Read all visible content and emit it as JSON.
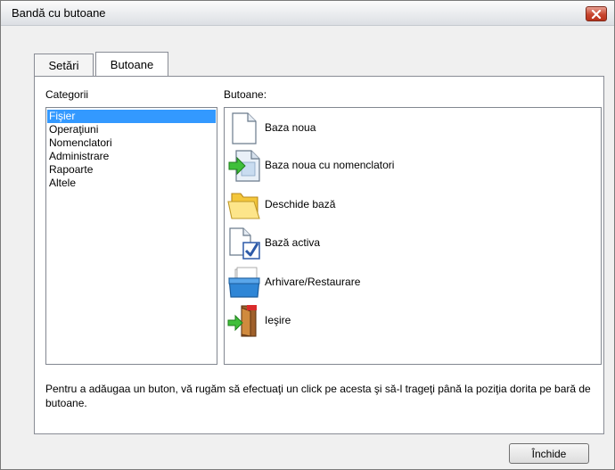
{
  "window": {
    "title": "Bandă cu butoane"
  },
  "tabs": [
    {
      "label": "Setări"
    },
    {
      "label": "Butoane"
    }
  ],
  "categories": {
    "label": "Categorii",
    "items": [
      "Fişier",
      "Operaţiuni",
      "Nomenclatori",
      "Administrare",
      "Rapoarte",
      "Altele"
    ],
    "selected": "Fişier"
  },
  "buttons": {
    "label": "Butoane:",
    "items": [
      {
        "label": "Baza noua",
        "icon": "new-document-icon"
      },
      {
        "label": "Baza noua cu nomenclatori",
        "icon": "new-document-arrow-icon"
      },
      {
        "label": "Deschide bază",
        "icon": "folder-open-icon"
      },
      {
        "label": "Bază activa",
        "icon": "document-check-icon"
      },
      {
        "label": "Arhivare/Restaurare",
        "icon": "archive-box-icon"
      },
      {
        "label": "Ieşire",
        "icon": "exit-door-icon"
      }
    ]
  },
  "hint": "Pentru a adăugaa un buton, vă rugăm să efectuaţi un click pe acesta şi să-l trageţi până la poziţia dorita pe bară de butoane.",
  "footer": {
    "close_label": "Închide"
  },
  "colors": {
    "selection": "#3399ff",
    "close_button_red": "#c8462f"
  }
}
